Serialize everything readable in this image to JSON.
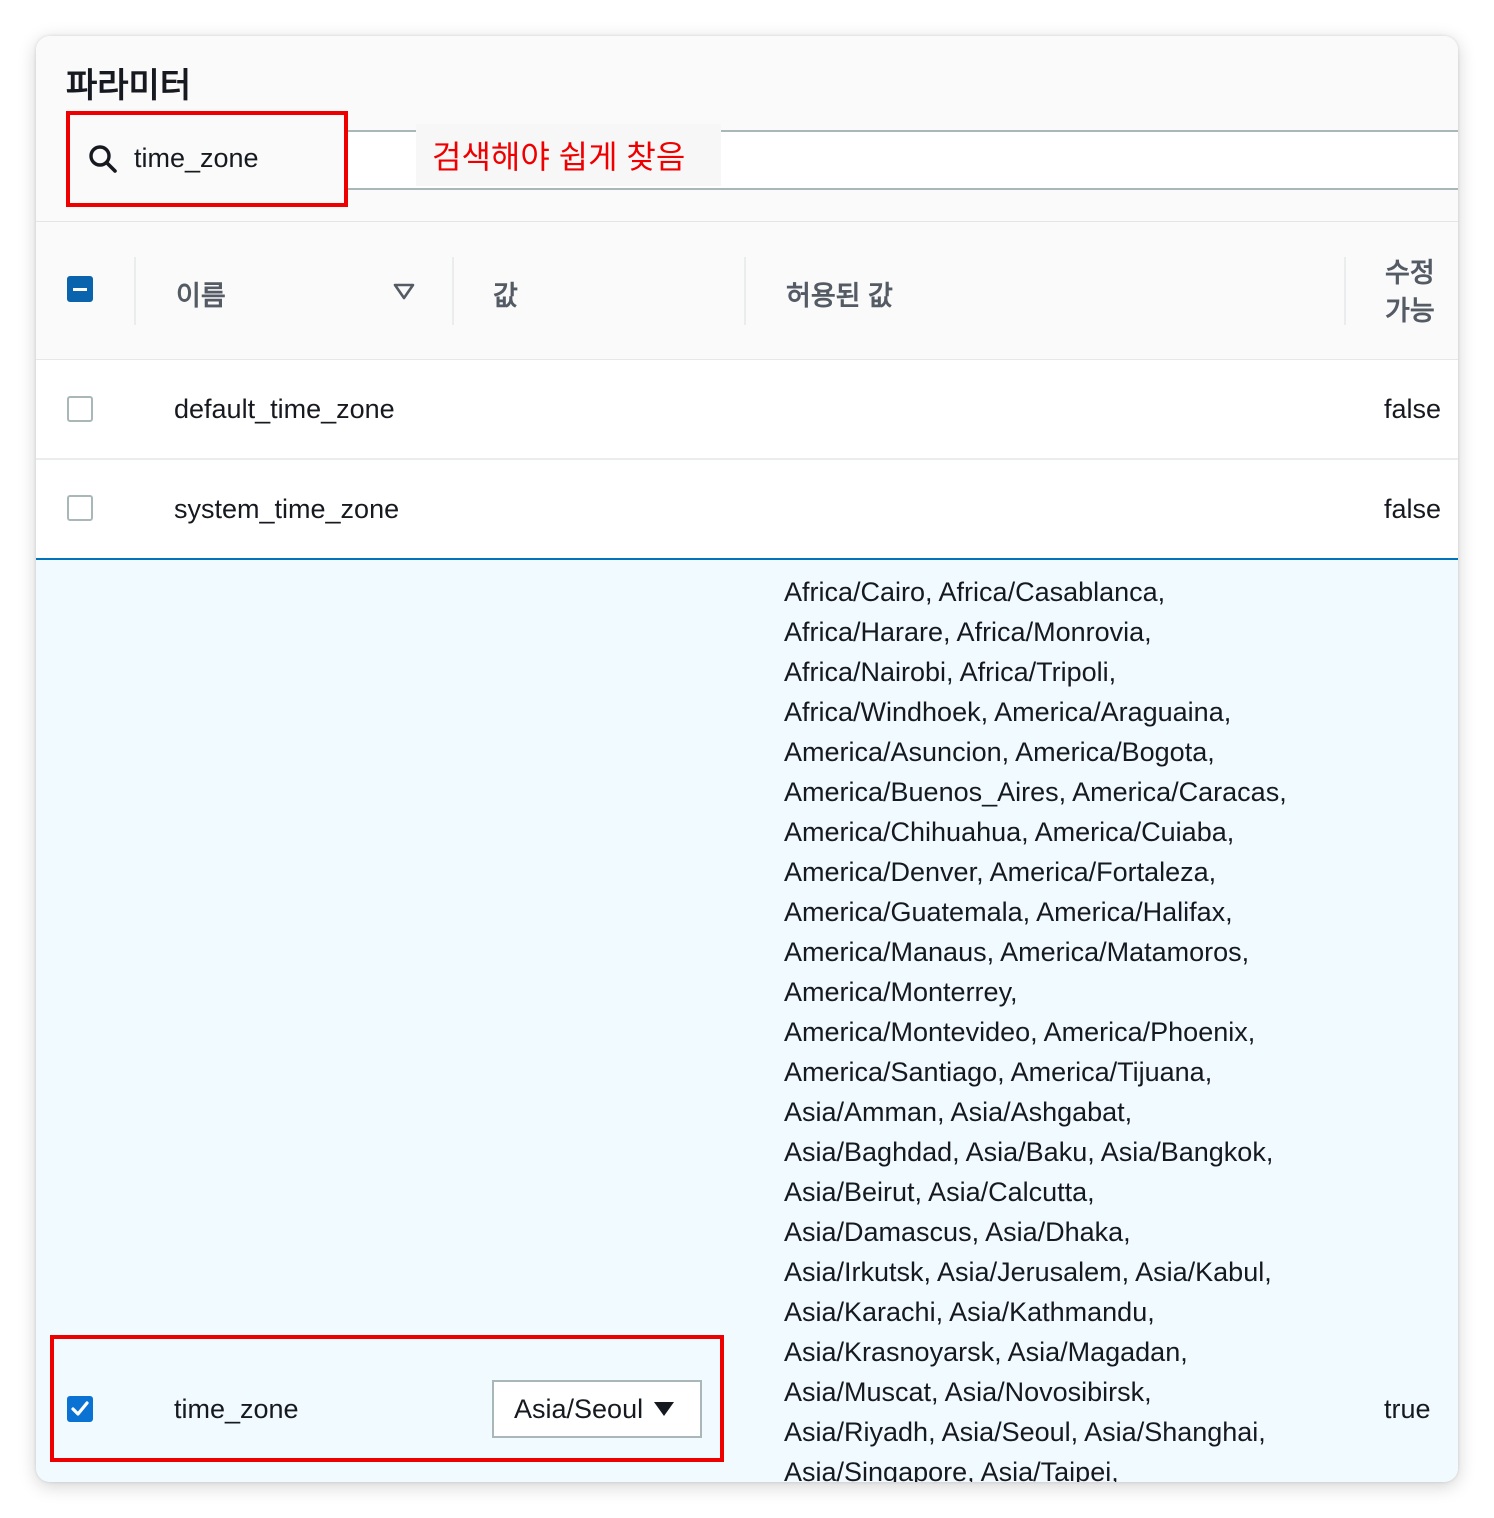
{
  "panel": {
    "title": "파라미터"
  },
  "search": {
    "value": "time_zone",
    "icon": "search-icon"
  },
  "annotation": {
    "text": "검색해야 쉽게 찾음",
    "color": "#ee0000"
  },
  "table": {
    "columns": {
      "name": "이름",
      "value": "값",
      "allowed": "허용된 값",
      "modifiable_line1": "수정",
      "modifiable_line2": "가능"
    },
    "rows": [
      {
        "name": "default_time_zone",
        "value": "",
        "allowed": "",
        "modifiable": "false",
        "selected": false
      },
      {
        "name": "system_time_zone",
        "value": "",
        "allowed": "",
        "modifiable": "false",
        "selected": false
      },
      {
        "name": "time_zone",
        "value": "Asia/Seoul",
        "modifiable": "true",
        "selected": true,
        "allowed_lines": [
          "Africa/Cairo, Africa/Casablanca,",
          "Africa/Harare, Africa/Monrovia,",
          "Africa/Nairobi, Africa/Tripoli,",
          "Africa/Windhoek, America/Araguaina,",
          "America/Asuncion, America/Bogota,",
          "America/Buenos_Aires, America/Caracas,",
          "America/Chihuahua, America/Cuiaba,",
          "America/Denver, America/Fortaleza,",
          "America/Guatemala, America/Halifax,",
          "America/Manaus, America/Matamoros,",
          "America/Monterrey,",
          "America/Montevideo, America/Phoenix,",
          "America/Santiago, America/Tijuana,",
          "Asia/Amman, Asia/Ashgabat,",
          "Asia/Baghdad, Asia/Baku, Asia/Bangkok,",
          "Asia/Beirut, Asia/Calcutta,",
          "Asia/Damascus, Asia/Dhaka,",
          "Asia/Irkutsk, Asia/Jerusalem, Asia/Kabul,",
          "Asia/Karachi, Asia/Kathmandu,",
          "Asia/Krasnoyarsk, Asia/Magadan,",
          "Asia/Muscat, Asia/Novosibirsk,",
          "Asia/Riyadh, Asia/Seoul, Asia/Shanghai,",
          "Asia/Singapore, Asia/Taipei,"
        ]
      }
    ]
  },
  "colors": {
    "highlight": "#ee0000",
    "selected_row_bg": "#f1faff",
    "checkbox_blue": "#0972d3"
  }
}
